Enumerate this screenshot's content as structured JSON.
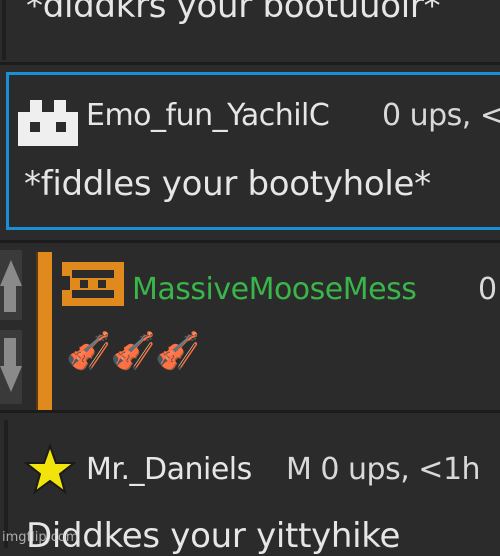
{
  "comments": [
    {
      "body": "*diddkrs your bootuuoir*"
    },
    {
      "username": "Emo_fun_YachilC",
      "meta": "0 ups, <",
      "body": "*fiddles your bootyhole*"
    },
    {
      "username": "MassiveMooseMess",
      "meta": "0",
      "body": "🎻🎻🎻"
    },
    {
      "username": "Mr._Daniels",
      "meta": "M   0 ups, <1h",
      "body": "Diddkes your yittyhike"
    }
  ],
  "watermark": "imgflip.com",
  "colors": {
    "selected_border": "#1a8fd6",
    "mod_accent": "#e08a1e",
    "mod_name": "#39b54a",
    "star": "#f2e40a"
  }
}
